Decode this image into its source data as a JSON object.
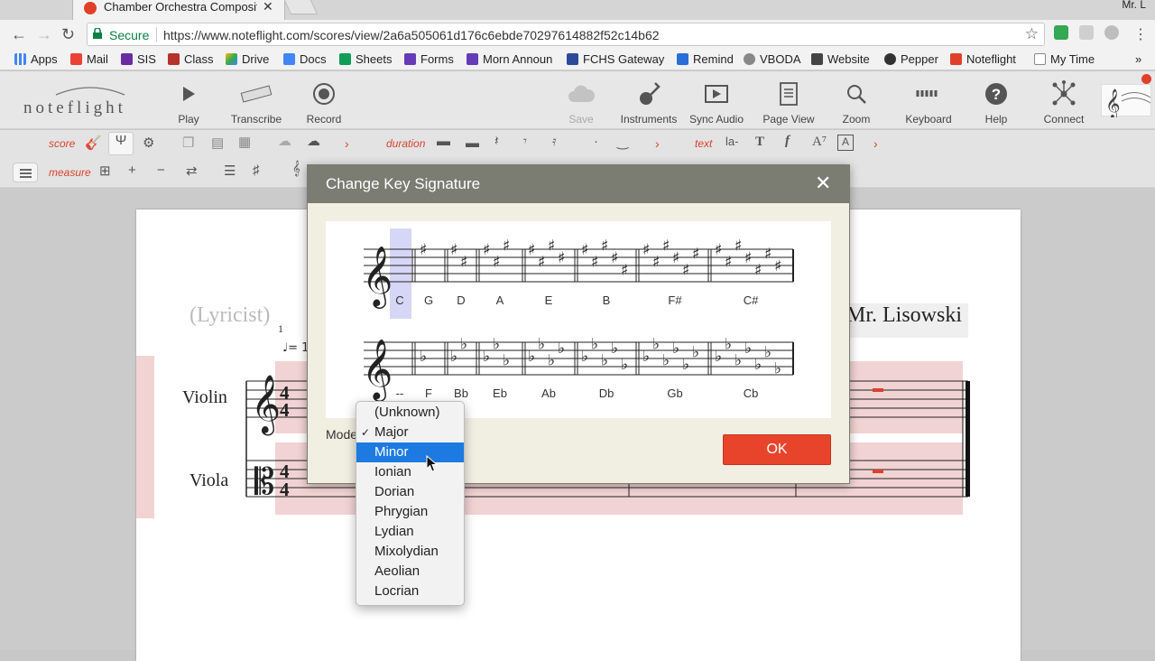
{
  "browser": {
    "tab_title": "Chamber Orchestra Compositi",
    "profile": "Mr. L",
    "secure_label": "Secure",
    "url": "https://www.noteflight.com/scores/view/2a6a505061d176c6ebde70297614882f52c14b62",
    "bookmarks": [
      "Apps",
      "Mail",
      "SIS",
      "Class",
      "Drive",
      "Docs",
      "Sheets",
      "Forms",
      "Morn Announ",
      "FCHS Gateway",
      "Remind",
      "VBODA",
      "Website",
      "Pepper",
      "Noteflight",
      "My Time"
    ]
  },
  "app": {
    "logo": "noteflight",
    "toolbar": {
      "play": "Play",
      "transcribe": "Transcribe",
      "record": "Record",
      "save": "Save",
      "instruments": "Instruments",
      "sync_audio": "Sync Audio",
      "page_view": "Page View",
      "zoom": "Zoom",
      "keyboard": "Keyboard",
      "help": "Help",
      "connect": "Connect"
    },
    "palette": {
      "score": "score",
      "duration": "duration",
      "text": "text",
      "measure": "measure"
    }
  },
  "score": {
    "lyricist": "(Lyricist)",
    "composer": "Mr. Lisowski",
    "measure_number": "1",
    "tempo": "♩= 1",
    "instruments": [
      "Violin",
      "Viola"
    ],
    "time_signature": "4/4"
  },
  "dialog": {
    "title": "Change Key Signature",
    "sharp_keys": [
      "C",
      "G",
      "D",
      "A",
      "E",
      "B",
      "F#",
      "C#"
    ],
    "flat_keys": [
      "--",
      "F",
      "Bb",
      "Eb",
      "Ab",
      "Db",
      "Gb",
      "Cb"
    ],
    "selected_key": "C",
    "mode_label": "Mode",
    "ok_label": "OK"
  },
  "mode_dropdown": {
    "options": [
      "(Unknown)",
      "Major",
      "Minor",
      "Ionian",
      "Dorian",
      "Phrygian",
      "Lydian",
      "Mixolydian",
      "Aeolian",
      "Locrian"
    ],
    "checked": "Major",
    "highlighted": "Minor"
  },
  "colors": {
    "accent": "#e8442c",
    "dialog_header": "#7b7c72",
    "dialog_bg": "#f1efe2",
    "dropdown_highlight": "#1d7ae0",
    "key_selection": "#d6d6f7"
  }
}
